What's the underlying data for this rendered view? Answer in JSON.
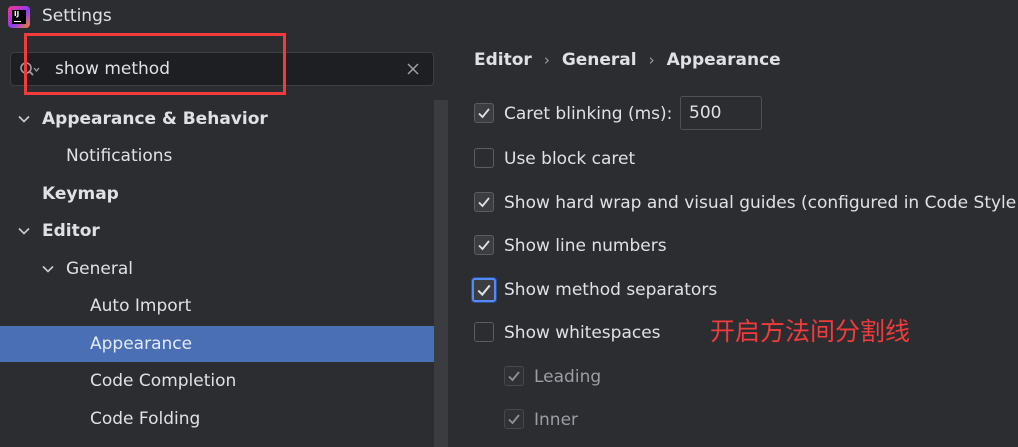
{
  "window": {
    "title": "Settings"
  },
  "search": {
    "value": "show method"
  },
  "tree": [
    {
      "label": "Appearance & Behavior",
      "bold": true,
      "expanded": true
    },
    {
      "label": "Notifications"
    },
    {
      "label": "Keymap",
      "bold": true
    },
    {
      "label": "Editor",
      "bold": true,
      "expanded": true
    },
    {
      "label": "General",
      "expanded": true
    },
    {
      "label": "Auto Import"
    },
    {
      "label": "Appearance",
      "selected": true
    },
    {
      "label": "Code Completion"
    },
    {
      "label": "Code Folding"
    }
  ],
  "breadcrumb": [
    "Editor",
    "General",
    "Appearance"
  ],
  "options": {
    "caret_blinking": {
      "label": "Caret blinking (ms):",
      "checked": true,
      "value": "500"
    },
    "block_caret": {
      "label": "Use block caret",
      "checked": false
    },
    "hard_wrap": {
      "label": "Show hard wrap and visual guides (configured in Code Style",
      "checked": true
    },
    "line_numbers": {
      "label": "Show line numbers",
      "checked": true
    },
    "method_separators": {
      "label": "Show method separators",
      "checked": true
    },
    "whitespaces": {
      "label": "Show whitespaces",
      "checked": false
    },
    "leading": {
      "label": "Leading",
      "checked": true
    },
    "inner": {
      "label": "Inner",
      "checked": true
    }
  },
  "annotation": "开启方法间分割线",
  "colors": {
    "accent": "#548af7",
    "selection": "#4a6fb4",
    "highlight": "#f23b3b"
  }
}
